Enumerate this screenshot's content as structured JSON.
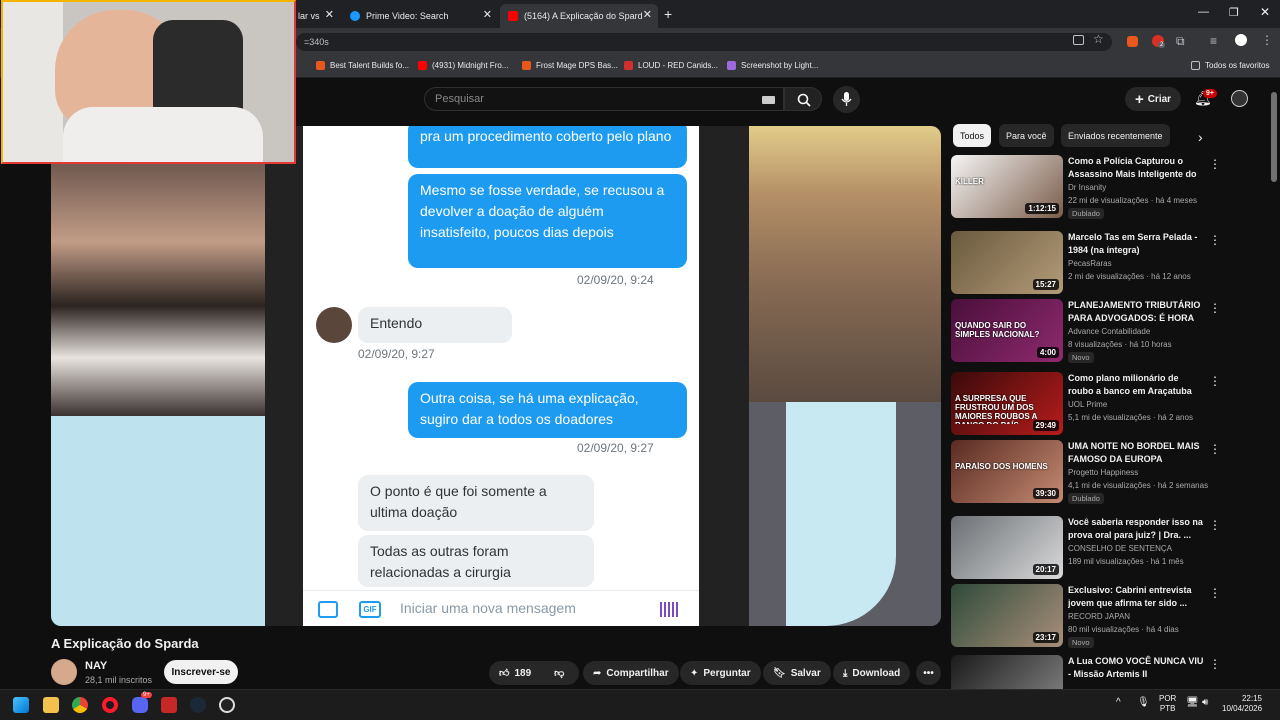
{
  "browser": {
    "tabs": [
      {
        "label": "lar vs",
        "active": false
      },
      {
        "label": "Prime Video: Search",
        "active": false
      },
      {
        "label": "(5164) A Explicação do Sparda",
        "active": true
      }
    ],
    "new_tab": "+",
    "url": "=340s",
    "bookmarks": [
      "Best Talent Builds fo...",
      "(4931) Midnight Fro...",
      "Frost Mage DPS Bas...",
      "LOUD - RED Canids...",
      "Screenshot by Light..."
    ],
    "all_bookmarks": "Todos os favoritos",
    "ext_badge": "2"
  },
  "youtube": {
    "search_placeholder": "Pesquisar",
    "create_label": "Criar",
    "notif_badge": "9+",
    "video_title": "A Explicação do Sparda",
    "channel_name": "NAY",
    "subscribers": "28,1 mil inscritos",
    "subscribe_label": "Inscrever-se",
    "likes": "189",
    "share_label": "Compartilhar",
    "ask_label": "Perguntar",
    "save_label": "Salvar",
    "download_label": "Download",
    "chips": [
      "Todos",
      "Para você",
      "Enviados recentemente"
    ]
  },
  "chat": {
    "b1": "pra um procedimento coberto pelo plano",
    "b2": "Mesmo se fosse verdade, se recusou a devolver a doação de alguém insatisfeito, poucos dias depois",
    "t1": "02/09/20, 9:24",
    "g1": "Entendo",
    "t2": "02/09/20, 9:27",
    "b3": "Outra coisa, se há uma explicação, sugiro dar a todos os doadores",
    "t3": "02/09/20, 9:27",
    "g2": "O ponto é que foi somente a ultima doação",
    "g3": "Todas as outras foram relacionadas a cirurgia",
    "input_placeholder": "Iniciar uma nova mensagem",
    "gif_label": "GIF"
  },
  "recommendations": [
    {
      "title": "Como a Polícia Capturou o Assassino Mais Inteligente do ...",
      "channel": "Dr Insanity",
      "meta": "22 mi de visualizações · há 4 meses",
      "badge": "Dublado",
      "duration": "1:12:15",
      "thumb_text": "KILLER",
      "colors": [
        "#f5f5f5",
        "#7a5c4a"
      ]
    },
    {
      "title": "Marcelo Tas em Serra Pelada - 1984 (na íntegra)",
      "channel": "PecasRaras",
      "meta": "2 mi de visualizações · há 12 anos",
      "badge": "",
      "duration": "15:27",
      "thumb_text": "",
      "colors": [
        "#6b5a3e",
        "#b39b78"
      ]
    },
    {
      "title": "PLANEJAMENTO TRIBUTÁRIO PARA ADVOGADOS: É HORA D...",
      "channel": "Advance Contabilidade",
      "meta": "8 visualizações · há 10 horas",
      "badge": "Novo",
      "duration": "4:00",
      "thumb_text": "QUANDO SAIR DO SIMPLES NACIONAL?",
      "colors": [
        "#4a0f3b",
        "#8e2a6e"
      ]
    },
    {
      "title": "Como plano milionário de roubo a banco em Araçatuba deu ...",
      "channel": "UOL Prime",
      "meta": "5,1 mi de visualizações · há 2 anos",
      "badge": "",
      "duration": "29:49",
      "thumb_text": "A SURPRESA QUE FRUSTROU UM DOS MAIORES ROUBOS A BANCO DO PAÍS",
      "colors": [
        "#3a0a0a",
        "#b71c1c"
      ]
    },
    {
      "title": "UMA NOITE NO BORDEL MAIS FAMOSO DA EUROPA",
      "channel": "Progetto Happiness",
      "meta": "4,1 mi de visualizações · há 2 semanas",
      "badge": "Dublado",
      "duration": "39:30",
      "thumb_text": "PARAÍSO DOS HOMENS",
      "colors": [
        "#5a2a22",
        "#c48b72"
      ]
    },
    {
      "title": "Você saberia responder isso na prova oral para juiz? | Dra. ...",
      "channel": "CONSELHO DE SENTENÇA",
      "meta": "189 mil visualizações · há 1 mês",
      "badge": "",
      "duration": "20:17",
      "thumb_text": "",
      "colors": [
        "#6b6f73",
        "#d9dadb"
      ]
    },
    {
      "title": "Exclusivo: Cabrini entrevista jovem que afirma ter sido ...",
      "channel": "RECORD JAPAN",
      "meta": "80 mil visualizações · há 4 dias",
      "badge": "Novo",
      "duration": "23:17",
      "thumb_text": "",
      "colors": [
        "#2f4a3a",
        "#a88f7a"
      ]
    },
    {
      "title": "A Lua COMO VOCÊ NUNCA VIU - Missão Artemis II",
      "channel": "",
      "meta": "",
      "badge": "",
      "duration": "",
      "thumb_text": "",
      "colors": [
        "#1a1a1a",
        "#8a8a8a"
      ]
    }
  ],
  "taskbar": {
    "lang": "POR",
    "layout": "PTB",
    "time": "22:15",
    "date": "10/04/2026",
    "discord_badge": "9+"
  }
}
